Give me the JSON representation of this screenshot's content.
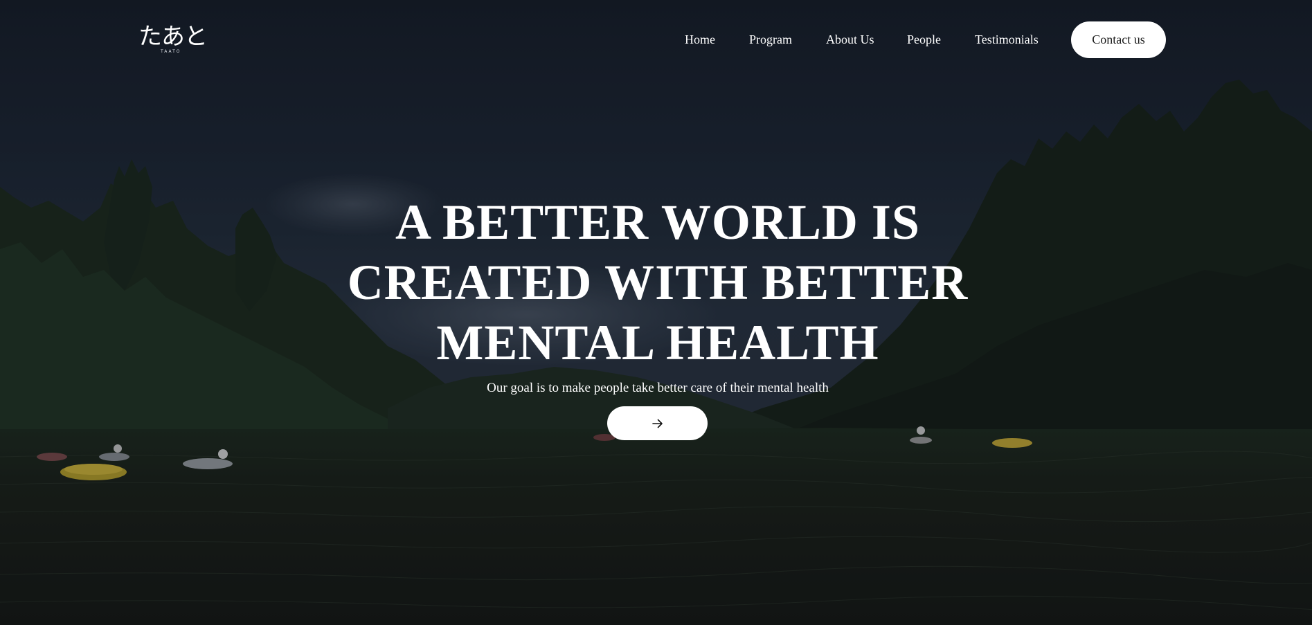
{
  "logo": {
    "mark": "たあと",
    "sub": "TAATO"
  },
  "nav": {
    "links": [
      {
        "label": "Home"
      },
      {
        "label": "Program"
      },
      {
        "label": "About Us"
      },
      {
        "label": "People"
      },
      {
        "label": "Testimonials"
      }
    ],
    "contact_label": "Contact us"
  },
  "hero": {
    "headline_lines": [
      "A BETTER WORLD IS",
      "CREATED WITH BETTER",
      "MENTAL HEALTH"
    ],
    "subtitle": "Our goal is to make people take better care of their mental health",
    "cta_icon": "arrow-right-icon"
  },
  "colors": {
    "button_bg": "#ffffff",
    "text": "#ffffff",
    "button_text": "#1a1a1a"
  }
}
